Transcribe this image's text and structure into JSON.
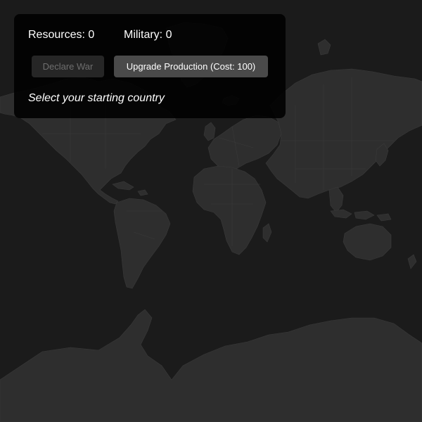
{
  "hud": {
    "resources_label": "Resources:",
    "resources_value": "0",
    "military_label": "Military:",
    "military_value": "0",
    "declare_war_label": "Declare War",
    "declare_war_enabled": false,
    "upgrade_label": "Upgrade Production (Cost: 100)",
    "status_message": "Select your starting country"
  },
  "theme": {
    "ocean": "#1b1b1b",
    "land": "#2e2e2e",
    "panel": "#000000",
    "button_active": "#4a4a4a",
    "button_disabled": "#262626",
    "text": "#ffffff"
  },
  "map": {
    "regions": [
      "north-america",
      "greenland",
      "south-america",
      "europe",
      "africa",
      "madagascar",
      "asia",
      "japan",
      "southeast-asia",
      "indonesia",
      "australia",
      "new-zealand",
      "antarctica",
      "svalbard",
      "iceland",
      "uk",
      "caribbean"
    ]
  }
}
